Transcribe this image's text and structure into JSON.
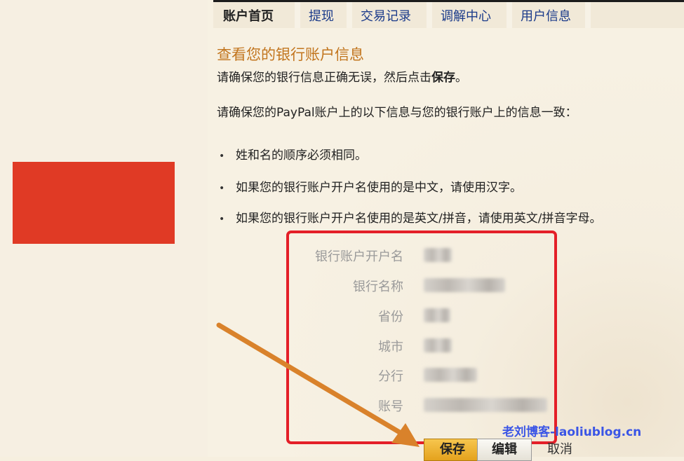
{
  "nav": {
    "tabs": [
      {
        "label": "账户首页",
        "active": true
      },
      {
        "label": "提现",
        "active": false
      },
      {
        "label": "交易记录",
        "active": false
      },
      {
        "label": "调解中心",
        "active": false
      },
      {
        "label": "用户信息",
        "active": false
      }
    ]
  },
  "page": {
    "title": "查看您的银行账户信息",
    "instruction_prefix": "请确保您的银行信息正确无误，然后点击",
    "instruction_action": "保存",
    "instruction_suffix": "。",
    "consistency_note": "请确保您的PayPal账户上的以下信息与您的银行账户上的信息一致：",
    "rules": [
      "姓和名的顺序必须相同。",
      "如果您的银行账户开户名使用的是中文，请使用汉字。",
      "如果您的银行账户开户名使用的是英文/拼音，请使用英文/拼音字母。"
    ]
  },
  "bank_info": {
    "fields": [
      {
        "label": "银行账户开户名"
      },
      {
        "label": "银行名称"
      },
      {
        "label": "省份"
      },
      {
        "label": "城市"
      },
      {
        "label": "分行"
      },
      {
        "label": "账号"
      }
    ]
  },
  "actions": {
    "save_label": "保存",
    "edit_label": "编辑",
    "cancel_label": "取消"
  },
  "watermark": {
    "text": "老刘博客-laoliublog.cn"
  },
  "colors": {
    "accent_title": "#c2751e",
    "highlight_border": "#e41f28",
    "annotation_arrow": "#d9822b",
    "red_block": "#e03a25",
    "watermark": "#3a55e6"
  }
}
